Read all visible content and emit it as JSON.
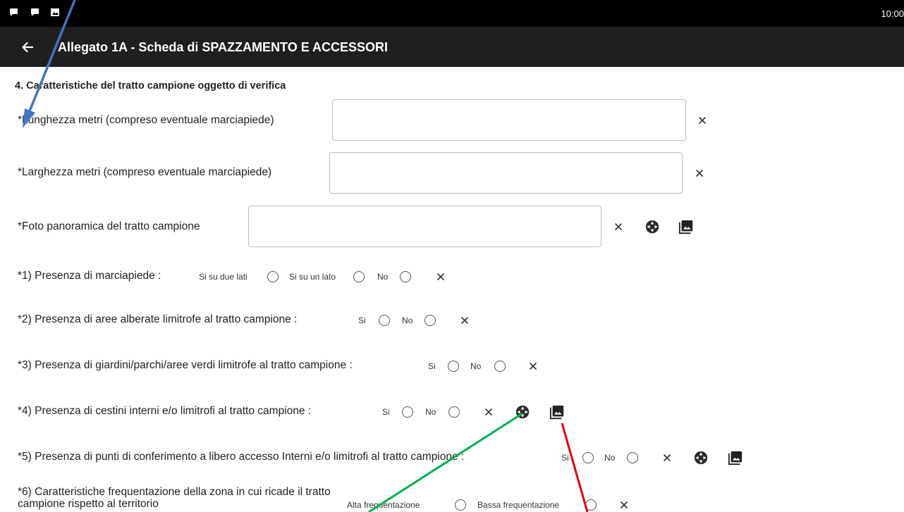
{
  "status_bar": {
    "time": "10:00"
  },
  "app_bar": {
    "title": "Allegato 1A - Scheda di SPAZZAMENTO E ACCESSORI"
  },
  "section": {
    "title": "4. Caratteristiche del tratto campione oggetto di verifica"
  },
  "fields": {
    "lunghezza": {
      "label": "*Lunghezza metri (compreso eventuale marciapiede)",
      "value": ""
    },
    "larghezza": {
      "label": "*Larghezza metri (compreso eventuale marciapiede)",
      "value": ""
    },
    "foto": {
      "label": "*Foto panoramica del tratto campione",
      "value": ""
    }
  },
  "questions": [
    {
      "label": "*1) Presenza di marciapiede :",
      "options": [
        "Si su due lati",
        "Si su un lato",
        "No"
      ]
    },
    {
      "label": "*2) Presenza di aree alberate limitrofe al tratto campione :",
      "options": [
        "Si",
        "No"
      ]
    },
    {
      "label": "*3) Presenza di giardini/parchi/aree verdi limitrofe al tratto campione :",
      "options": [
        "Si",
        "No"
      ]
    },
    {
      "label": "*4) Presenza di cestini interni e/o limitrofi al tratto campione :",
      "options": [
        "Si",
        "No"
      ]
    },
    {
      "label": "*5) Presenza di punti di conferimento a libero accesso Interni e/o limitrofi al tratto campione :",
      "options": [
        "Si",
        "No"
      ]
    },
    {
      "label": "*6) Caratteristiche frequentazione della zona in cui ricade il tratto campione rispetto al territorio",
      "options": [
        "Alta frequentazione",
        "Bassa frequentazione"
      ]
    }
  ],
  "icons": {
    "status": [
      "chat-bubble-icon",
      "chat-bubble-icon",
      "image-notification-icon"
    ],
    "back": "arrow-back-icon",
    "clear": "close-icon",
    "camera": "camera-shutter-icon",
    "gallery": "photo-library-icon"
  },
  "annotations": {
    "blue_arrow_color": "#4472c4",
    "green_line_color": "#00b050",
    "red_line_color": "#e00000"
  },
  "colors": {
    "status_bar": "#000000",
    "app_bar": "#1f1f1f",
    "field_border": "#bdbdbd",
    "text": "#222222"
  }
}
